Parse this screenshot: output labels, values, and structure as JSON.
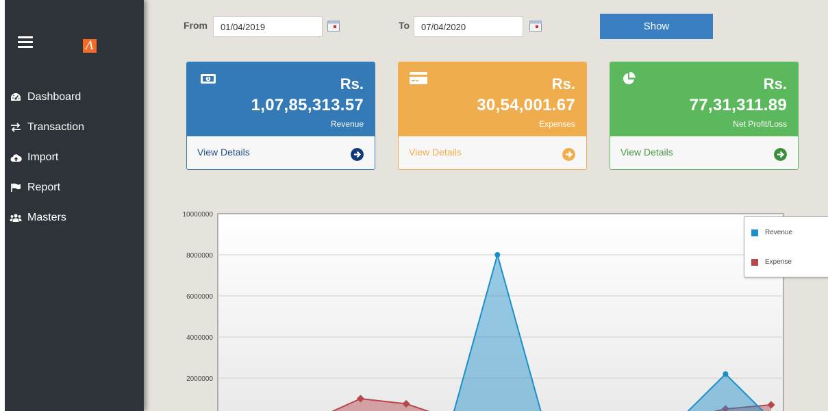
{
  "sidebar": {
    "logo_glyph": "Λ",
    "items": [
      {
        "label": "Dashboard",
        "icon": "dashboard-icon"
      },
      {
        "label": "Transaction",
        "icon": "exchange-icon"
      },
      {
        "label": "Import",
        "icon": "cloud-upload-icon"
      },
      {
        "label": "Report",
        "icon": "flag-icon"
      },
      {
        "label": "Masters",
        "icon": "users-icon"
      }
    ]
  },
  "filter": {
    "from_label": "From",
    "from_value": "01/04/2019",
    "to_label": "To",
    "to_value": "07/04/2020",
    "show_label": "Show"
  },
  "cards": [
    {
      "currency": "Rs.",
      "amount": "1,07,85,313.57",
      "label": "Revenue",
      "link": "View Details",
      "color": "#337ab7",
      "icon": "money-icon"
    },
    {
      "currency": "Rs.",
      "amount": "30,54,001.67",
      "label": "Expenses",
      "link": "View Details",
      "color": "#f0ad4e",
      "icon": "credit-card-icon"
    },
    {
      "currency": "Rs.",
      "amount": "77,31,311.89",
      "label": "Net Profit/Loss",
      "link": "View Details",
      "color": "#5cb85c",
      "icon": "pie-chart-icon"
    }
  ],
  "chart_data": {
    "type": "area",
    "y_ticks": [
      "10000000",
      "8000000",
      "6000000",
      "4000000",
      "2000000"
    ],
    "ylim": [
      0,
      10000000
    ],
    "grid": true,
    "legend_position": "top-right",
    "series": [
      {
        "name": "Revenue",
        "color": "#1a8fca",
        "points": [
          [
            0,
            0
          ],
          [
            1,
            0
          ],
          [
            2,
            0
          ],
          [
            3,
            0
          ],
          [
            4,
            0
          ],
          [
            5,
            0
          ],
          [
            6,
            0
          ],
          [
            7,
            8000000
          ],
          [
            8,
            0
          ],
          [
            9,
            0
          ],
          [
            10,
            0
          ],
          [
            11,
            0
          ],
          [
            12,
            2200000
          ],
          [
            13,
            0
          ]
        ]
      },
      {
        "name": "Expense",
        "color": "#b5484c",
        "points": [
          [
            0,
            0
          ],
          [
            1,
            0
          ],
          [
            2,
            0
          ],
          [
            3,
            0
          ],
          [
            4,
            1000000
          ],
          [
            5,
            750000
          ],
          [
            6,
            0
          ],
          [
            7,
            0
          ],
          [
            8,
            0
          ],
          [
            9,
            0
          ],
          [
            10,
            0
          ],
          [
            11,
            0
          ],
          [
            12,
            500000
          ],
          [
            13,
            700000
          ]
        ]
      }
    ]
  }
}
